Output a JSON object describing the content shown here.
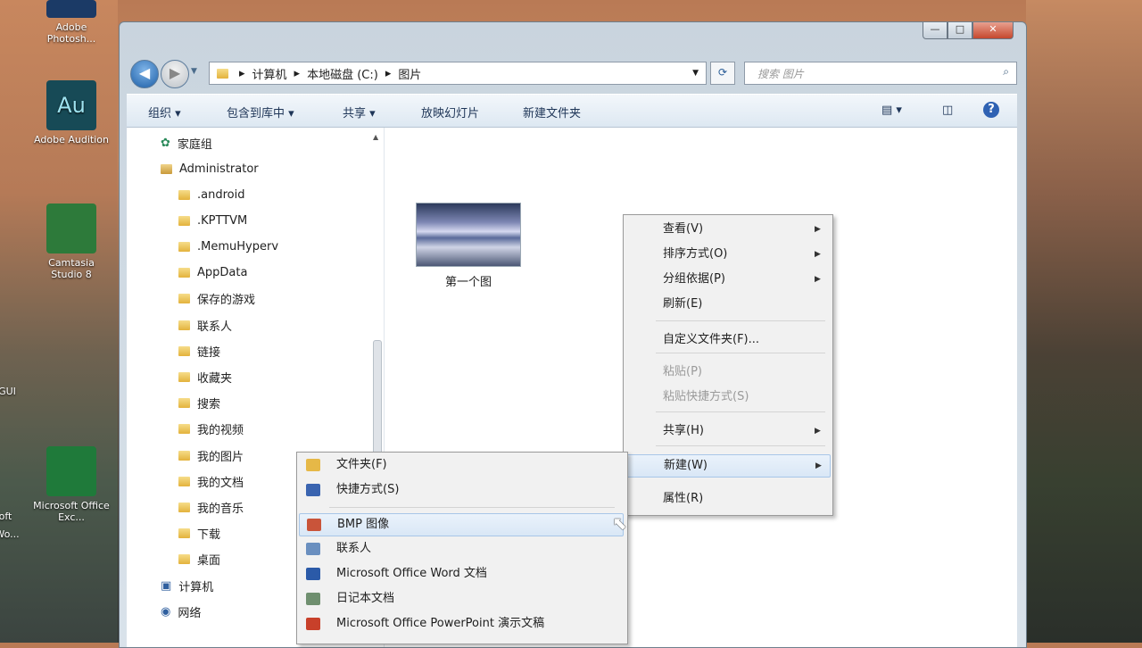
{
  "desktop": {
    "icons": [
      {
        "id": "photoshop",
        "label": "Adobe Photosh...",
        "color": "#1b3a66"
      },
      {
        "id": "audition",
        "label": "Adobe Audition",
        "color": "#174a56",
        "glyph": "Au"
      },
      {
        "id": "camtasia",
        "label": "Camtasia Studio 8",
        "color": "#2d7a3a"
      },
      {
        "id": "excel",
        "label": "Microsoft Office Exc...",
        "color": "#1f7a3a"
      }
    ],
    "edge_labels": [
      "GUI",
      "oft",
      "Wo..."
    ]
  },
  "window": {
    "controls": {
      "min": "—",
      "max": "□",
      "close": "✕"
    },
    "address": {
      "segments": [
        "计算机",
        "本地磁盘 (C:)",
        "图片"
      ]
    },
    "search_placeholder": "搜索 图片",
    "toolbar": {
      "organize": "组织 ▾",
      "include": "包含到库中 ▾",
      "share": "共享 ▾",
      "slideshow": "放映幻灯片",
      "new_folder": "新建文件夹"
    },
    "nav": {
      "homegroup": "家庭组",
      "admin": "Administrator",
      "folders": [
        ".android",
        ".KPTTVM",
        ".MemuHyperv",
        "AppData",
        "保存的游戏",
        "联系人",
        "链接",
        "收藏夹",
        "搜索",
        "我的视频",
        "我的图片",
        "我的文档",
        "我的音乐",
        "下载",
        "桌面"
      ],
      "computer": "计算机",
      "network": "网络"
    },
    "file": {
      "name": "第一个图"
    }
  },
  "context_menu": {
    "items": [
      {
        "label": "查看(V)",
        "submenu": true
      },
      {
        "label": "排序方式(O)",
        "submenu": true
      },
      {
        "label": "分组依据(P)",
        "submenu": true
      },
      {
        "label": "刷新(E)",
        "submenu": false
      },
      {
        "label": "自定义文件夹(F)...",
        "submenu": false
      },
      {
        "label": "粘贴(P)",
        "disabled": true
      },
      {
        "label": "粘贴快捷方式(S)",
        "disabled": true
      },
      {
        "label": "共享(H)",
        "submenu": true
      },
      {
        "label": "新建(W)",
        "submenu": true,
        "highlighted": true
      },
      {
        "label": "属性(R)",
        "submenu": false
      }
    ]
  },
  "new_submenu": {
    "items": [
      {
        "label": "文件夹(F)",
        "icon": "folder-icon"
      },
      {
        "label": "快捷方式(S)",
        "icon": "shortcut-icon"
      },
      {
        "label": "BMP 图像",
        "icon": "bmp-icon",
        "highlighted": true
      },
      {
        "label": "联系人",
        "icon": "contact-icon"
      },
      {
        "label": "Microsoft Office Word 文档",
        "icon": "word-icon"
      },
      {
        "label": "日记本文档",
        "icon": "journal-icon"
      },
      {
        "label": "Microsoft Office PowerPoint 演示文稿",
        "icon": "powerpoint-icon"
      }
    ]
  }
}
